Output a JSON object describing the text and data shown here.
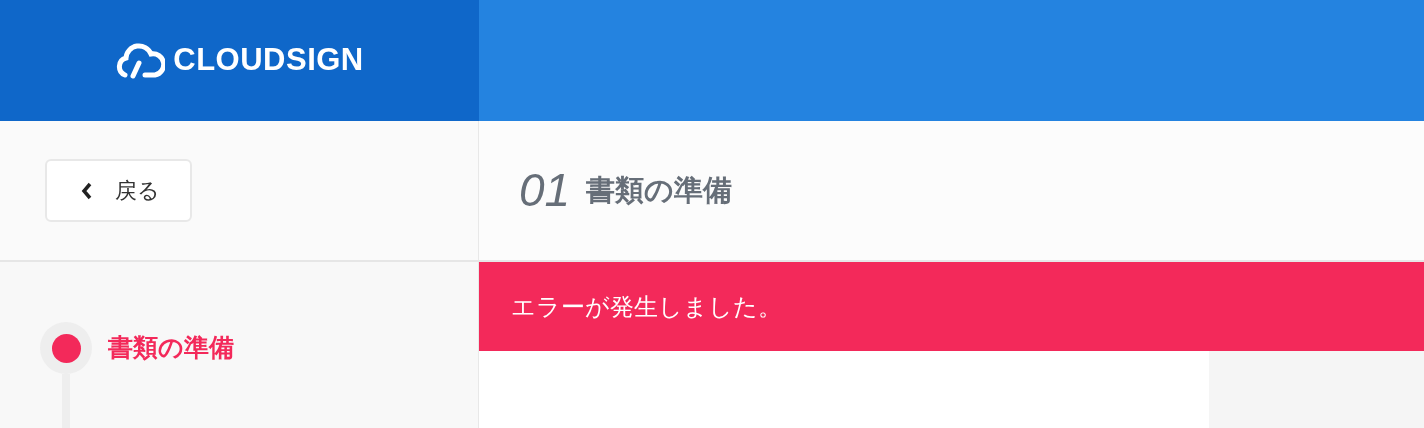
{
  "header": {
    "logo_text": "CLOUDSIGN"
  },
  "back_button": {
    "label": "戻る"
  },
  "page_title": {
    "number": "01",
    "title": "書類の準備"
  },
  "steps": [
    {
      "label": "書類の準備",
      "selected": true
    }
  ],
  "alert": {
    "message": "エラーが発生しました。"
  }
}
